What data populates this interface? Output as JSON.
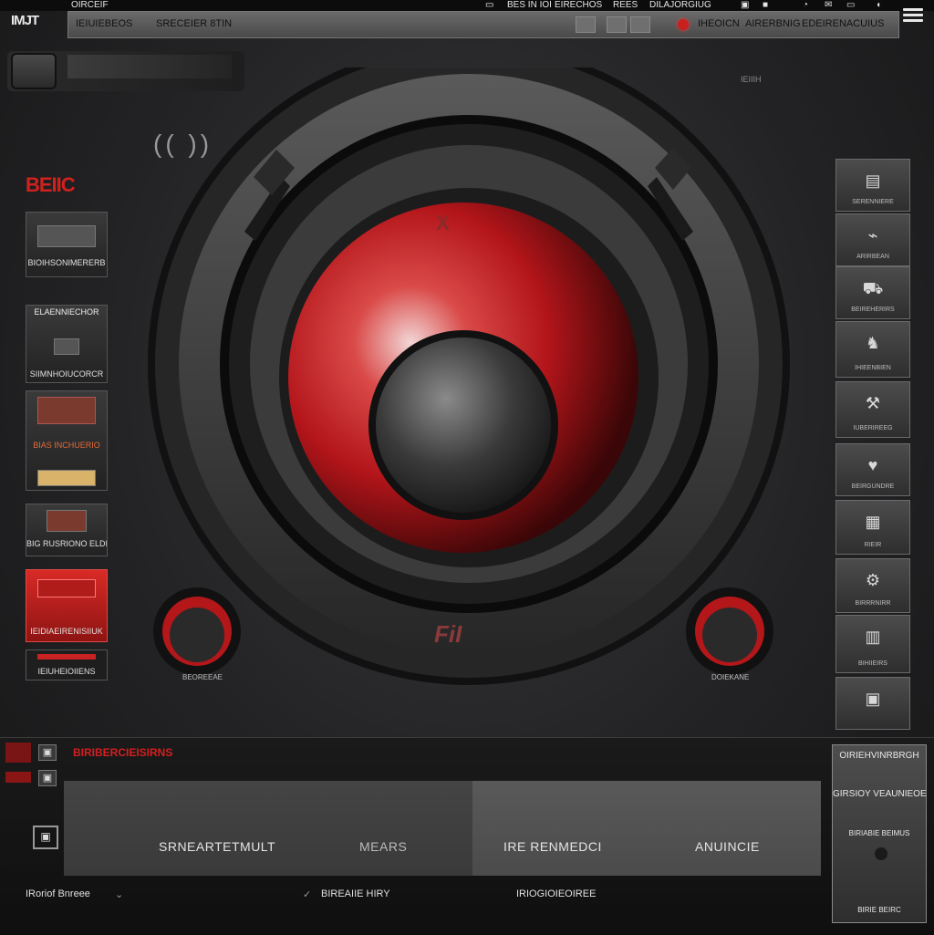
{
  "app": {
    "logo": "IMJT"
  },
  "system_bar": {
    "left_label": "OIRCEIF",
    "items": [
      "BES IN IOI",
      "EIRECHOS",
      "REES",
      "DILAJORGIUG"
    ]
  },
  "menu": {
    "tab1": "IEIUIEBEOS",
    "tab2": "SRECEIER 8TIN",
    "right_items": [
      "IHEOICN",
      "AIRERBNIG",
      "EDEIRENACUIUS"
    ]
  },
  "top_strip": {
    "label": "IEIIIH"
  },
  "speaker": {
    "center_mark": "X",
    "brand": "FiI"
  },
  "left_panel": {
    "brand": "BEIIC",
    "panels": [
      {
        "title": "",
        "caption": "BIOIHSONIMERERB"
      },
      {
        "title": "ELAENNIECHOR",
        "caption": "SIIMNHOIUCORCR"
      },
      {
        "title": "",
        "caption": "BIAS INCHUERIO"
      },
      {
        "title": "",
        "caption": "BIG RUSRIONO ELDIANIGUNAS"
      },
      {
        "title": "",
        "caption": "IEIDIAEIRENISIIUK"
      },
      {
        "title": "",
        "caption": "IEIUHEIOIIENS"
      }
    ]
  },
  "right_panel": {
    "items": [
      {
        "icon": "film-icon",
        "label": "SERENNIERE"
      },
      {
        "icon": "plug-icon",
        "label": "ARIRBEAN"
      },
      {
        "icon": "car-icon",
        "label": "BEIREHERIRS"
      },
      {
        "icon": "figure-icon",
        "label": "IHIEENBIEN"
      },
      {
        "icon": "tools-icon",
        "label": "IUBERIREEG"
      },
      {
        "icon": "heart-icon",
        "label": "BEIRGUNDRE"
      },
      {
        "icon": "screen-icon",
        "label": "RIEIR"
      },
      {
        "icon": "gear-icon",
        "label": "BIRRRNIRR"
      },
      {
        "icon": "book-icon",
        "label": "BIHIIEIRS"
      },
      {
        "icon": "box-icon",
        "label": ""
      }
    ]
  },
  "knobs": {
    "left_label": "BEOREEAE",
    "right_label": "DOIEKANE"
  },
  "bottom": {
    "title": "BIRIBERCIEISIRNS",
    "tabs": [
      "SRNEARTETMULT",
      "MEARS",
      "IRE RENMEDCI",
      "ANUINCIE"
    ],
    "footer": {
      "device": "IRoriof Bnreee",
      "status": "BIREAIIE HIRY",
      "mode": "IRIOGIOIEOIREE"
    },
    "side_panel": {
      "title": "OIRIEHVINRBRGH",
      "label": "GIRSIOY VEAUNIEOE",
      "sub": "BIRIABIE BEIMUS",
      "foot": "BIRIE BEIRC"
    }
  },
  "colors": {
    "accent": "#d0211e",
    "dark": "#1c1c1d",
    "panel": "#3a3a3a"
  }
}
